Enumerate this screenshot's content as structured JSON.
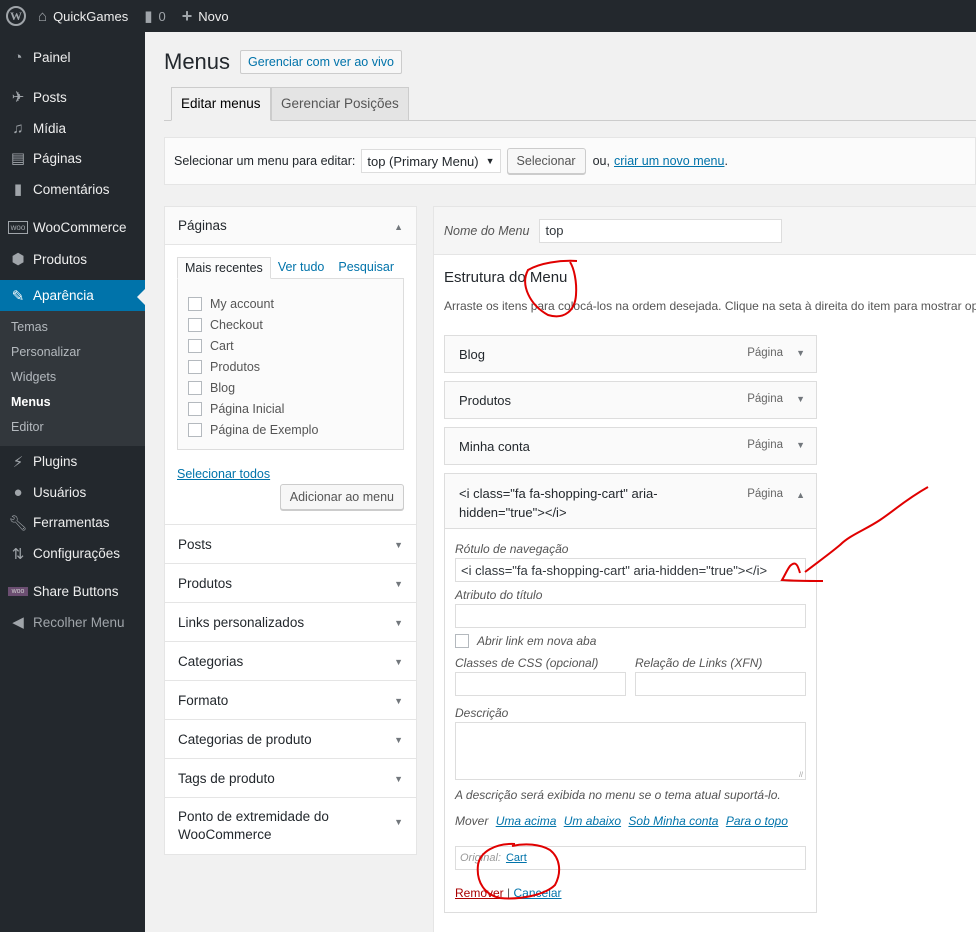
{
  "adminbar": {
    "site_name": "QuickGames",
    "comments_count": "0",
    "new_label": "Novo"
  },
  "sidebar": {
    "items": [
      {
        "label": "Painel",
        "icon": "dashboard-icon"
      },
      {
        "label": "Posts",
        "icon": "pushpin-icon"
      },
      {
        "label": "Mídia",
        "icon": "media-icon"
      },
      {
        "label": "Páginas",
        "icon": "pages-icon"
      },
      {
        "label": "Comentários",
        "icon": "comment-icon"
      },
      {
        "label": "WooCommerce",
        "icon": "woocommerce-icon"
      },
      {
        "label": "Produtos",
        "icon": "box-icon"
      },
      {
        "label": "Aparência",
        "icon": "paintbrush-icon"
      },
      {
        "label": "Plugins",
        "icon": "plugin-icon"
      },
      {
        "label": "Usuários",
        "icon": "user-icon"
      },
      {
        "label": "Ferramentas",
        "icon": "wrench-icon"
      },
      {
        "label": "Configurações",
        "icon": "settings-icon"
      },
      {
        "label": "Share Buttons",
        "icon": "share-icon"
      },
      {
        "label": "Recolher Menu",
        "icon": "collapse-icon"
      }
    ],
    "submenu": [
      "Temas",
      "Personalizar",
      "Widgets",
      "Menus",
      "Editor"
    ],
    "accent": "#0073aa"
  },
  "header": {
    "title": "Menus",
    "live_button": "Gerenciar com ver ao vivo"
  },
  "tabs": [
    "Editar menus",
    "Gerenciar Posições"
  ],
  "manage": {
    "label": "Selecionar um menu para editar:",
    "selected": "top (Primary Menu)",
    "select_button": "Selecionar",
    "or_text": "ou,",
    "create_link": "criar um novo menu",
    "period": "."
  },
  "pages_box": {
    "title": "Páginas",
    "subtabs": [
      "Mais recentes",
      "Ver tudo",
      "Pesquisar"
    ],
    "pages": [
      "My account",
      "Checkout",
      "Cart",
      "Produtos",
      "Blog",
      "Página Inicial",
      "Página de Exemplo"
    ],
    "select_all": "Selecionar todos",
    "add_button": "Adicionar ao menu"
  },
  "collapsed_boxes": [
    "Posts",
    "Produtos",
    "Links personalizados",
    "Categorias",
    "Formato",
    "Categorias de produto",
    "Tags de produto",
    "Ponto de extremidade do WooCommerce"
  ],
  "menu_editor": {
    "name_label": "Nome do Menu",
    "name_value": "top",
    "structure_title": "Estrutura do Menu",
    "hint": "Arraste os itens para colocá-los na ordem desejada. Clique na seta à direita do item para mostrar opções",
    "items": [
      {
        "title": "Blog",
        "type": "Página"
      },
      {
        "title": "Produtos",
        "type": "Página"
      },
      {
        "title": "Minha conta",
        "type": "Página"
      },
      {
        "title": "<i class=\"fa fa-shopping-cart\" aria-hidden=\"true\"></i>",
        "type": "Página"
      }
    ],
    "settings": {
      "nav_label": "Rótulo de navegação",
      "nav_value": "<i class=\"fa fa-shopping-cart\" aria-hidden=\"true\"></i>",
      "title_attr_label": "Atributo do título",
      "title_attr_value": "",
      "new_tab_label": "Abrir link em nova aba",
      "css_label": "Classes de CSS (opcional)",
      "xfn_label": "Relação de Links (XFN)",
      "desc_label": "Descrição",
      "desc_note": "A descrição será exibida no menu se o tema atual suportá-lo.",
      "move_label": "Mover",
      "move_links": [
        "Uma acima",
        "Um abaixo",
        "Sob Minha conta",
        "Para o topo"
      ],
      "original_label": "Original:",
      "original_link": "Cart",
      "remove": "Remover",
      "separator": "|",
      "cancel": "Cancelar"
    }
  },
  "annotation_color": "#e00000"
}
